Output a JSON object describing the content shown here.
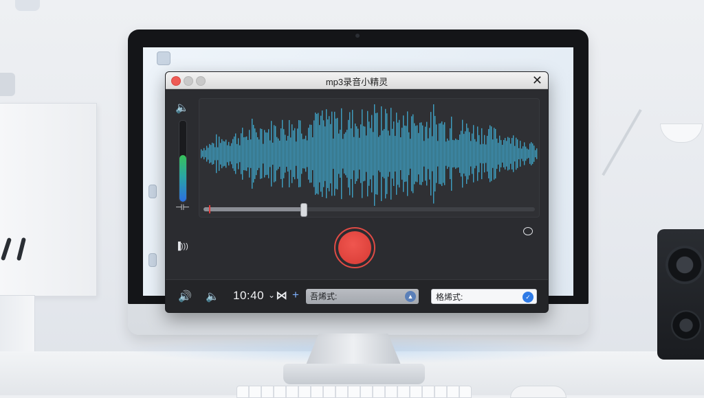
{
  "window": {
    "title": "mp3录音小精灵",
    "close_glyph": "✕"
  },
  "left_rail": {
    "volume_icon": "🔈",
    "input_level_percent": 58,
    "split_icon": "⊣⊢",
    "wave_icon": "▐)))"
  },
  "waveform": {
    "color_start": "#4a8fe0",
    "color_end": "#35b3a8",
    "playback_progress_percent": 30,
    "thumb_position_percent": 30
  },
  "bottom_bar": {
    "volume_icon": "🔊",
    "mute_icon": "🔈",
    "time": "10:40",
    "chevron": "⌄",
    "split_glyph": "⋈",
    "add_glyph": "+",
    "format_select_1": "吾烯式:",
    "format_select_2": "格烯式:"
  },
  "colors": {
    "record_red": "#e04b45",
    "level_green": "#38c15a",
    "level_blue": "#2c6fe0"
  }
}
